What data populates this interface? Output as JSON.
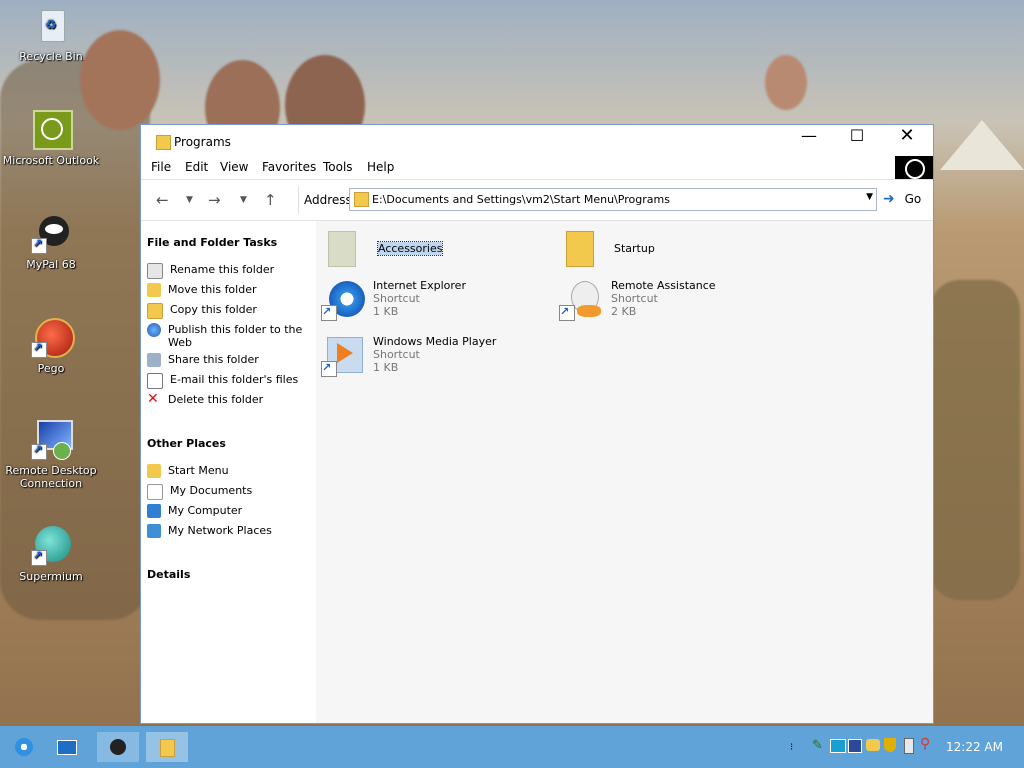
{
  "desktop": {
    "icons": [
      {
        "label": "Recycle Bin"
      },
      {
        "label": "Microsoft Outlook"
      },
      {
        "label": "MyPal 68"
      },
      {
        "label": "Pego"
      },
      {
        "label": "Remote Desktop Connection"
      },
      {
        "label": "Supermium"
      }
    ]
  },
  "window": {
    "title": "Programs",
    "menu": [
      "File",
      "Edit",
      "View",
      "Favorites",
      "Tools",
      "Help"
    ],
    "address_label": "Address",
    "address_value": "E:\\Documents and Settings\\vm2\\Start Menu\\Programs",
    "go_label": "Go",
    "left_pane": {
      "tasks_header": "File and Folder Tasks",
      "tasks": [
        "Rename this folder",
        "Move this folder",
        "Copy this folder",
        "Publish this folder to the Web",
        "Share this folder",
        "E-mail this folder's files",
        "Delete this folder"
      ],
      "other_header": "Other Places",
      "places": [
        "Start Menu",
        "My Documents",
        "My Computer",
        "My Network Places"
      ],
      "details_header": "Details"
    },
    "items": [
      {
        "name": "Accessories",
        "selected": true
      },
      {
        "name": "Startup"
      },
      {
        "name": "Internet Explorer",
        "type": "Shortcut",
        "size": "1 KB"
      },
      {
        "name": "Remote Assistance",
        "type": "Shortcut",
        "size": "2 KB"
      },
      {
        "name": "Windows Media Player",
        "type": "Shortcut",
        "size": "1 KB"
      }
    ]
  },
  "taskbar": {
    "clock": "12:22 AM"
  },
  "colors": {
    "taskbar": "#5fa3d8",
    "folder": "#f2c94c",
    "selection": "#bfd6f1"
  }
}
